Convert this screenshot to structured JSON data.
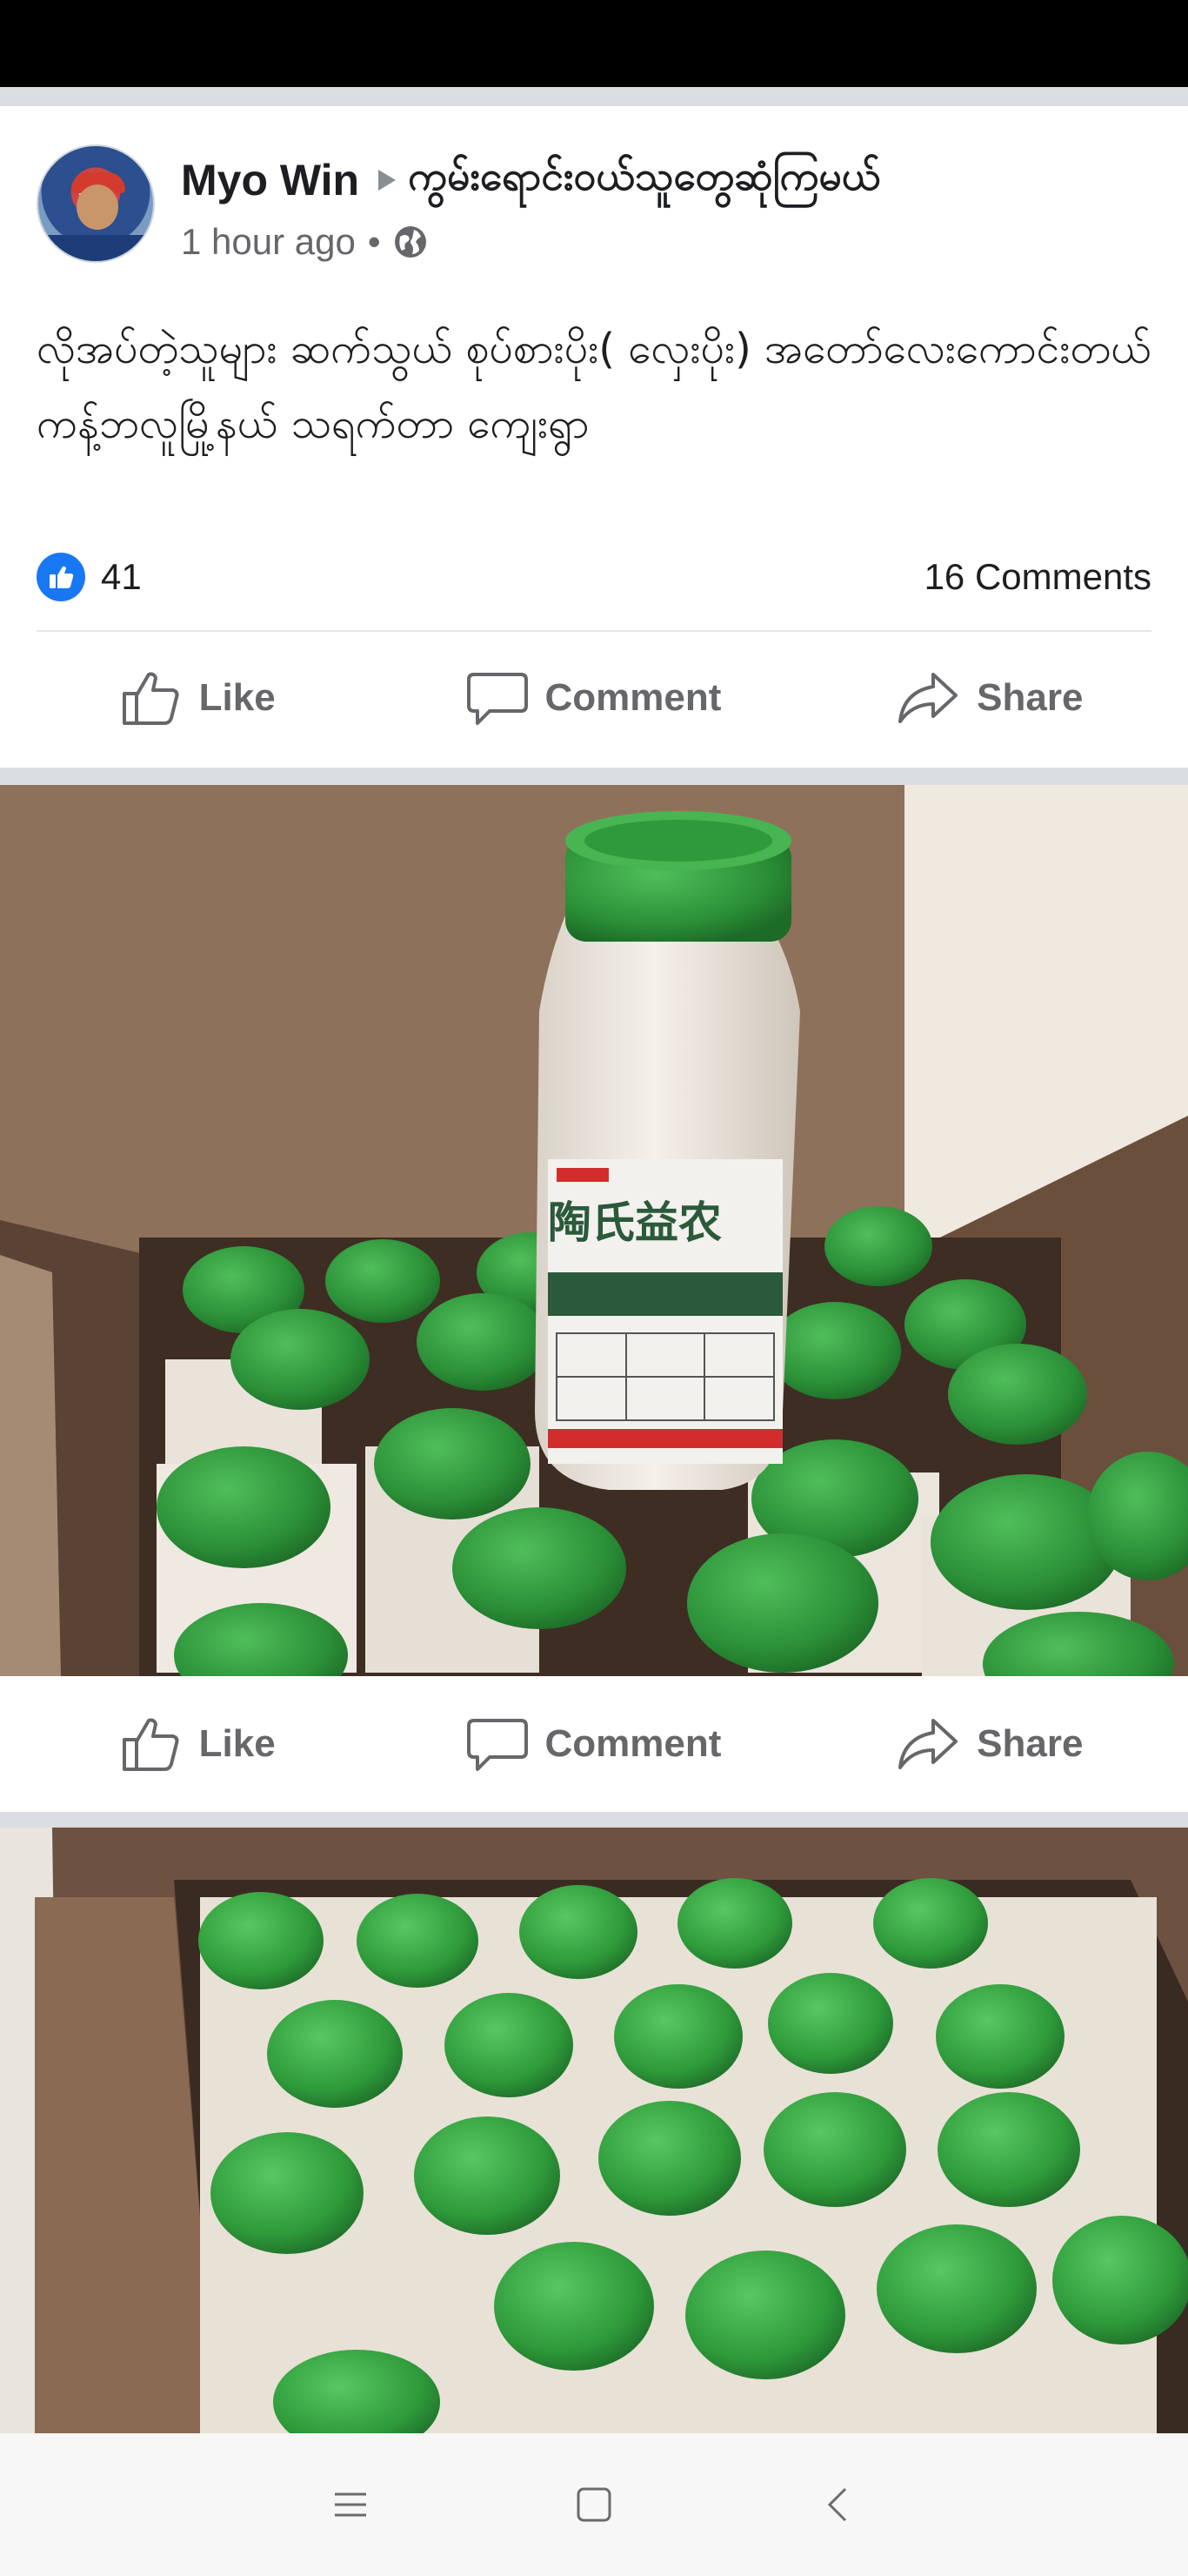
{
  "post": {
    "author": "Myo Win",
    "group": "ကွမ်းရောင်းဝယ်သူတွေဆုံကြမယ်",
    "time": "1 hour ago",
    "time_separator": "•",
    "privacy_icon": "globe-icon",
    "text": "လိုအပ်တဲ့သူများ ဆက်သွယ် စုပ်စားပိုး( လှေးပိုး) အတော်လေးကောင်းတယ် ကန့်ဘလူမြို့နယ် သရက်တာ ကျေးရွာ",
    "reactions": {
      "like_count": "41",
      "comments": "16 Comments"
    }
  },
  "actions": {
    "like": "Like",
    "comment": "Comment",
    "share": "Share"
  },
  "photo_actions": {
    "like": "Like",
    "comment": "Comment",
    "share": "Share"
  },
  "photos": [
    {
      "label": "陶氏益农"
    }
  ],
  "colors": {
    "brand": "#1877f2",
    "cap_green": "#2e9e3e",
    "box": "#7a5c47",
    "bottle": "#f1ede6"
  },
  "nav": {
    "menu_icon": "menu-icon",
    "home_icon": "home-icon",
    "back_icon": "back-icon"
  }
}
